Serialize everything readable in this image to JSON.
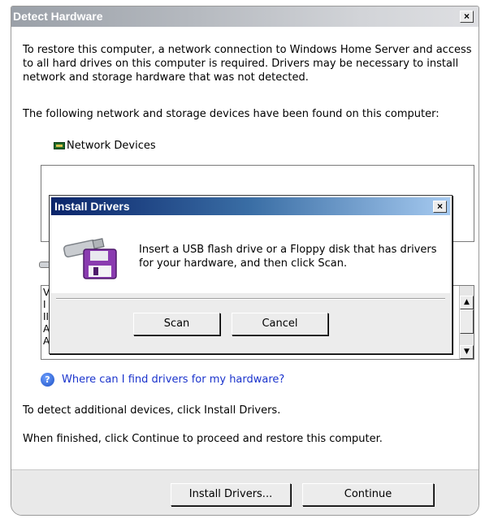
{
  "main_window": {
    "title": "Detect Hardware",
    "close_glyph": "×",
    "intro_text": "To restore this computer, a network connection to Windows Home Server and access to all hard drives on this computer is required. Drivers may be necessary to install network and storage hardware that was not detected.",
    "found_text": "The following network and storage devices have been found on this computer:",
    "network_label": "Network Devices",
    "storage_rows": [
      "V",
      "I",
      "II",
      "A",
      "A"
    ],
    "help_link": "Where can I find drivers for my hardware?",
    "detect_text": "To detect additional devices, click Install Drivers.",
    "finished_text": "When finished, click Continue to proceed and restore this computer.",
    "install_button": "Install Drivers...",
    "continue_button": "Continue"
  },
  "dialog": {
    "title": "Install Drivers",
    "close_glyph": "×",
    "message": "Insert a USB flash drive or a Floppy disk that has drivers for your hardware, and then click Scan.",
    "scan_button": "Scan",
    "cancel_button": "Cancel"
  },
  "icons": {
    "network": "network-card-icon",
    "storage": "storage-drive-icon",
    "help": "help-icon",
    "usb": "usb-floppy-icon"
  },
  "colors": {
    "link": "#1a33cc",
    "dialog_title_start": "#0a246a",
    "dialog_title_end": "#a6caf0"
  }
}
